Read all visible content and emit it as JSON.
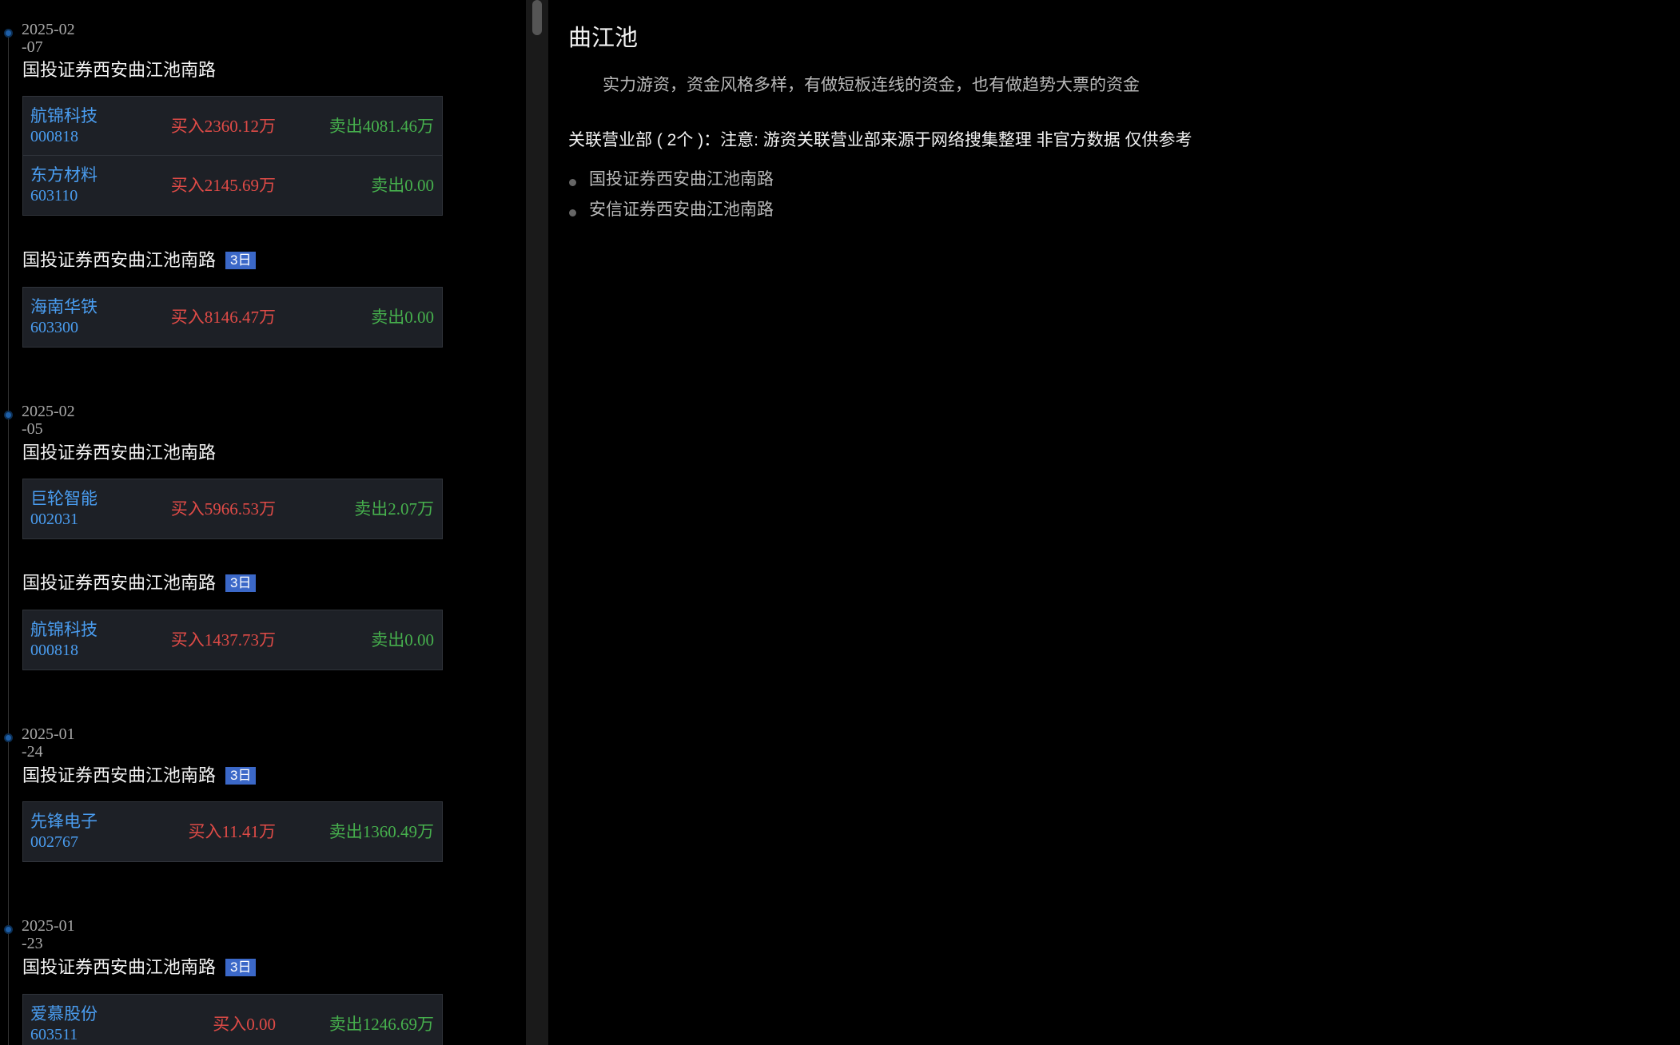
{
  "days": [
    {
      "date": "2025-02-07",
      "groups": [
        {
          "branch": "国投证券西安曲江池南路",
          "badge": "",
          "trades": [
            {
              "name": "航锦科技",
              "code": "000818",
              "buy": "买入2360.12万",
              "sell": "卖出4081.46万"
            },
            {
              "name": "东方材料",
              "code": "603110",
              "buy": "买入2145.69万",
              "sell": "卖出0.00"
            }
          ]
        },
        {
          "branch": "国投证券西安曲江池南路",
          "badge": "3日",
          "trades": [
            {
              "name": "海南华铁",
              "code": "603300",
              "buy": "买入8146.47万",
              "sell": "卖出0.00"
            }
          ]
        }
      ]
    },
    {
      "date": "2025-02-05",
      "groups": [
        {
          "branch": "国投证券西安曲江池南路",
          "badge": "",
          "trades": [
            {
              "name": "巨轮智能",
              "code": "002031",
              "buy": "买入5966.53万",
              "sell": "卖出2.07万"
            }
          ]
        },
        {
          "branch": "国投证券西安曲江池南路",
          "badge": "3日",
          "trades": [
            {
              "name": "航锦科技",
              "code": "000818",
              "buy": "买入1437.73万",
              "sell": "卖出0.00"
            }
          ]
        }
      ]
    },
    {
      "date": "2025-01-24",
      "groups": [
        {
          "branch": "国投证券西安曲江池南路",
          "badge": "3日",
          "trades": [
            {
              "name": "先锋电子",
              "code": "002767",
              "buy": "买入11.41万",
              "sell": "卖出1360.49万"
            }
          ]
        }
      ]
    },
    {
      "date": "2025-01-23",
      "groups": [
        {
          "branch": "国投证券西安曲江池南路",
          "badge": "3日",
          "trades": [
            {
              "name": "爱慕股份",
              "code": "603511",
              "buy": "买入0.00",
              "sell": "卖出1246.69万"
            }
          ]
        }
      ]
    }
  ],
  "detail": {
    "title": "曲江池",
    "description": "实力游资，资金风格多样，有做短板连线的资金，也有做趋势大票的资金",
    "associated_label": "关联营业部 ( 2个 )：注意: 游资关联营业部来源于网络搜集整理 非官方数据 仅供参考",
    "branches": [
      "国投证券西安曲江池南路",
      "安信证券西安曲江池南路"
    ]
  },
  "colors": {
    "link_blue": "#4a9df0",
    "buy_red": "#e04b47",
    "sell_green": "#46b04d",
    "badge_blue": "#3b68c8"
  }
}
